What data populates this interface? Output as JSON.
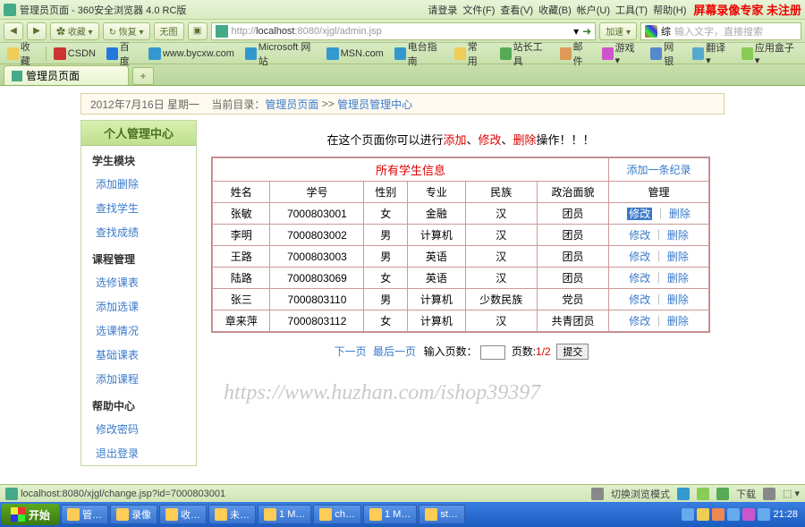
{
  "browser": {
    "window_title": "管理员页面 - 360安全浏览器 4.0 RC版",
    "menu": {
      "login": "请登录",
      "file": "文件(F)",
      "view": "查看(V)",
      "favorites": "收藏(B)",
      "account": "帐户(U)",
      "tools": "工具(T)",
      "help": "帮助(H)"
    },
    "banner": "屏幕录像专家 未注册",
    "nav": {
      "back": "◀",
      "fwd": "▶",
      "fav": "✿ 收藏 ▾",
      "restore": "↻ 恢复 ▾",
      "nopic": "无图",
      "refresh": "▣"
    },
    "address": {
      "prefix": "http://",
      "host": "localhost",
      "port": ":8080",
      "path": "/xjgl/admin.jsp"
    },
    "search": {
      "engine": "综",
      "placeholder": "输入文字，直接搜索"
    },
    "bookmarks": [
      {
        "label": "收藏"
      },
      {
        "label": "CSDN"
      },
      {
        "label": "百度"
      },
      {
        "label": "www.bycxw.com"
      },
      {
        "label": "Microsoft 网站"
      },
      {
        "label": "MSN.com"
      },
      {
        "label": "电台指南"
      },
      {
        "label": "常用"
      }
    ],
    "toolbar_right": {
      "sitetools": "站长工具",
      "mail": "邮件",
      "jiasu": "加速 ▾",
      "wangyin": "网银",
      "fanyi": "翻译 ▾",
      "appbox": "应用盒子 ▾"
    },
    "tab": {
      "label": "管理员页面"
    }
  },
  "page": {
    "breadcrumb": {
      "date": "2012年7月16日 星期一",
      "label": "当前目录：",
      "link1": "管理员页面",
      "sep": ">>",
      "link2": "管理员管理中心"
    },
    "sidebar": {
      "title": "个人管理中心",
      "sections": [
        {
          "heading": "学生模块",
          "items": [
            "添加删除",
            "查找学生",
            "查找成绩"
          ]
        },
        {
          "heading": "课程管理",
          "items": [
            "选修课表",
            "添加选课",
            "选课情况",
            "基础课表",
            "添加课程"
          ]
        },
        {
          "heading": "帮助中心",
          "items": [
            "修改密码",
            "退出登录"
          ]
        }
      ]
    },
    "instruction": {
      "pre": "在这个页面你可以进行",
      "add": "添加",
      "mod": "修改",
      "del": "删除",
      "post": "操作！！！"
    },
    "table": {
      "title": "所有学生信息",
      "add_link": "添加一条纪录",
      "headers": [
        "姓名",
        "学号",
        "性别",
        "专业",
        "民族",
        "政治面貌",
        "管理"
      ],
      "rows": [
        {
          "name": "张敏",
          "id": "7000803001",
          "sex": "女",
          "major": "金融",
          "eth": "汉",
          "pol": "团员"
        },
        {
          "name": "李明",
          "id": "7000803002",
          "sex": "男",
          "major": "计算机",
          "eth": "汉",
          "pol": "团员"
        },
        {
          "name": "王路",
          "id": "7000803003",
          "sex": "男",
          "major": "英语",
          "eth": "汉",
          "pol": "团员"
        },
        {
          "name": "陆路",
          "id": "7000803069",
          "sex": "女",
          "major": "英语",
          "eth": "汉",
          "pol": "团员"
        },
        {
          "name": "张三",
          "id": "7000803110",
          "sex": "男",
          "major": "计算机",
          "eth": "少数民族",
          "pol": "党员"
        },
        {
          "name": "章来萍",
          "id": "7000803112",
          "sex": "女",
          "major": "计算机",
          "eth": "汉",
          "pol": "共青团员"
        }
      ],
      "ops": {
        "edit": "修改",
        "del": "删除",
        "sep": "｜"
      }
    },
    "pager": {
      "next": "下一页",
      "last": "最后一页",
      "input_label": "输入页数：",
      "page_label": "页数:",
      "pages": "1/2",
      "submit": "提交"
    },
    "watermark": "https://www.huzhan.com/ishop39397"
  },
  "statusbar": {
    "left": "localhost:8080/xjgl/change.jsp?id=7000803001",
    "mode": "切换浏览模式",
    "download": "下载",
    "zoom": "⬚"
  },
  "taskbar": {
    "start": "开始",
    "items": [
      "管…",
      "录像",
      "收…",
      "未…",
      "1 M…",
      "ch…",
      "1 M…",
      "st…"
    ],
    "time": "21:28"
  }
}
